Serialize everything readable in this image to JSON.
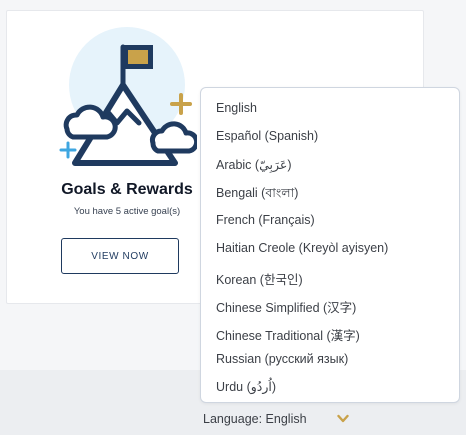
{
  "card": {
    "title": "Goals & Rewards",
    "subtitle": "You have 5 active goal(s)",
    "button_label": "VIEW NOW"
  },
  "language_menu": {
    "options": [
      "English",
      "Español (Spanish)",
      "Arabic (عَرَبِيّ)",
      "Bengali (বাংলা)",
      "French (Français)",
      "Haitian Creole (Kreyòl ayisyen)",
      "Korean (한국인)",
      "Chinese Simplified (汉字)",
      "Chinese Traditional (漢字)",
      "Russian (русский язык)",
      "Urdu (اُردُو)"
    ]
  },
  "footer": {
    "language_label": "Language: English"
  },
  "icons": {
    "illustration": "mountain-flag-icon",
    "dropdown": "chevron-down-icon"
  },
  "colors": {
    "navy": "#1f3a5f",
    "gold": "#c9a24a",
    "light_blue": "#3ea6e0",
    "circle": "#e6f3fb"
  }
}
